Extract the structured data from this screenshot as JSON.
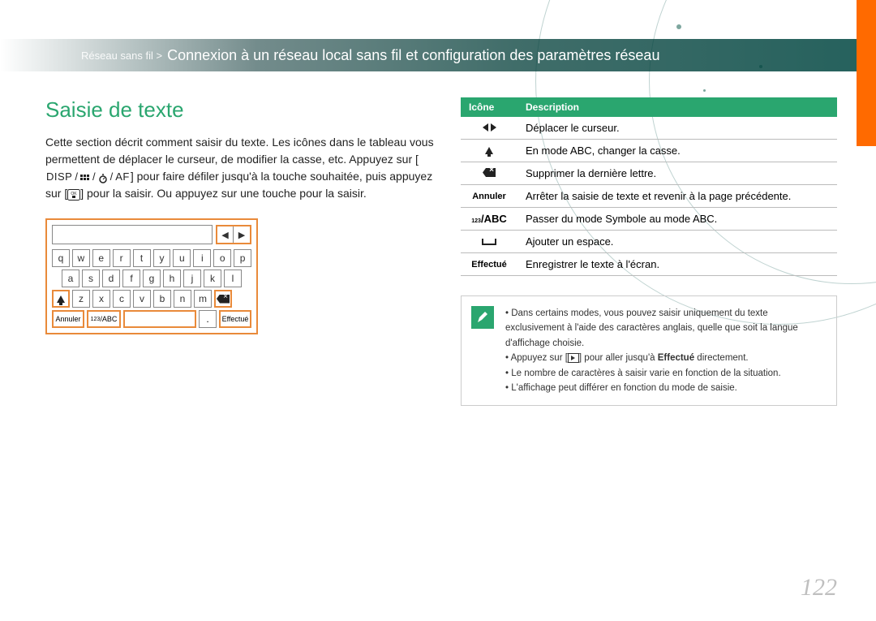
{
  "header": {
    "breadcrumb": "Réseau sans fil >",
    "title": "Connexion à un réseau local sans fil et configuration des paramètres réseau"
  },
  "section": {
    "heading": "Saisie de texte",
    "intro_before": "Cette section décrit comment saisir du texte. Les icônes dans le tableau vous permettent de déplacer le curseur, de modifier la casse, etc. Appuyez sur [",
    "disp": "DISP",
    "af": "AF",
    "intro_mid": "] pour faire défiler jusqu'à la touche souhaitée, puis appuyez sur [",
    "ok": "OK",
    "intro_after": "] pour la saisir. Ou appuyez sur une touche pour la saisir."
  },
  "keyboard": {
    "row1": [
      "q",
      "w",
      "e",
      "r",
      "t",
      "y",
      "u",
      "i",
      "o",
      "p"
    ],
    "row2": [
      "a",
      "s",
      "d",
      "f",
      "g",
      "h",
      "j",
      "k",
      "l"
    ],
    "row3": [
      "z",
      "x",
      "c",
      "v",
      "b",
      "n",
      "m"
    ],
    "cancel": "Annuler",
    "mode": "/ABC",
    "mode_prefix": "123",
    "dot": ".",
    "done": "Effectué"
  },
  "table": {
    "head_icon": "Icône",
    "head_desc": "Description",
    "rows": [
      {
        "desc": "Déplacer le curseur."
      },
      {
        "desc": "En mode ABC, changer la casse."
      },
      {
        "desc": "Supprimer la dernière lettre."
      },
      {
        "icon_text": "Annuler",
        "desc": "Arrêter la saisie de texte et revenir à la page précédente."
      },
      {
        "icon_text": "/ABC",
        "icon_prefix": "123",
        "desc": "Passer du mode Symbole au mode ABC."
      },
      {
        "desc": "Ajouter un espace."
      },
      {
        "icon_text": "Effectué",
        "desc": "Enregistrer le texte à l'écran."
      }
    ]
  },
  "notes": {
    "n1": "Dans certains modes, vous pouvez saisir uniquement du texte exclusivement à l'aide des caractères anglais, quelle que soit la langue d'affichage choisie.",
    "n2a": "Appuyez sur [",
    "n2b": "] pour aller jusqu'à ",
    "n2_bold": "Effectué",
    "n2c": " directement.",
    "n3": "Le nombre de caractères à saisir varie en fonction de la situation.",
    "n4": "L'affichage peut différer en fonction du mode de saisie."
  },
  "page_number": "122"
}
